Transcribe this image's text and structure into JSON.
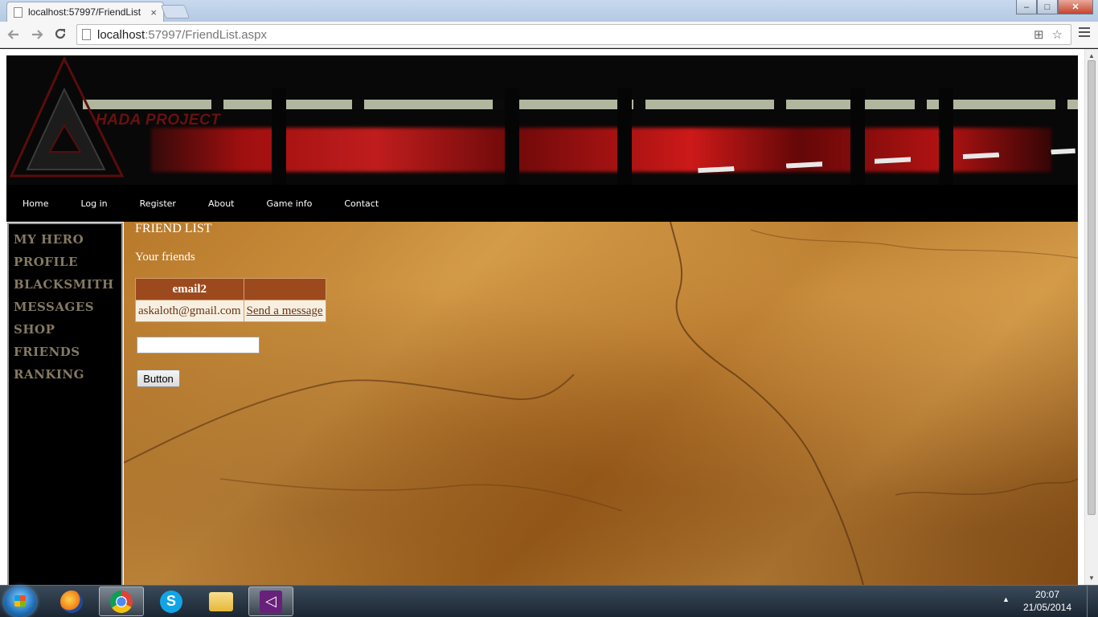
{
  "browser": {
    "tab_title": "localhost:57997/FriendList",
    "tab_close": "×",
    "url_host": "localhost",
    "url_rest": ":57997/FriendList.aspx",
    "back_icon": "arrow-left",
    "forward_icon": "arrow-right",
    "reload_icon": "reload",
    "window_buttons": {
      "minimize": "–",
      "maximize": "□",
      "close": "✕"
    }
  },
  "site": {
    "brand": "HADA PROJECT",
    "colors": {
      "nav_bg": "#000000",
      "sidebar_text": "#857a62",
      "table_header": "#9c4a1d"
    },
    "topnav": [
      {
        "label": "Home"
      },
      {
        "label": "Log in"
      },
      {
        "label": "Register"
      },
      {
        "label": "About"
      },
      {
        "label": "Game info"
      },
      {
        "label": "Contact"
      }
    ],
    "sidebar": [
      {
        "label": "MY HERO"
      },
      {
        "label": "PROFILE"
      },
      {
        "label": "BLACKSMITH"
      },
      {
        "label": "MESSAGES"
      },
      {
        "label": "SHOP"
      },
      {
        "label": "FRIENDS"
      },
      {
        "label": "RANKING"
      }
    ]
  },
  "main": {
    "heading": "FRIEND LIST",
    "subheading": "Your friends",
    "table": {
      "headers": [
        "email2",
        ""
      ],
      "rows": [
        {
          "email": "askaloth@gmail.com",
          "action": "Send a message"
        }
      ]
    },
    "input_value": "",
    "button_label": "Button"
  },
  "taskbar": {
    "apps": [
      "start",
      "firefox",
      "chrome",
      "skype",
      "file-explorer",
      "visual-studio"
    ],
    "tray_arrow": "▲",
    "time": "20:07",
    "date": "21/05/2014"
  }
}
